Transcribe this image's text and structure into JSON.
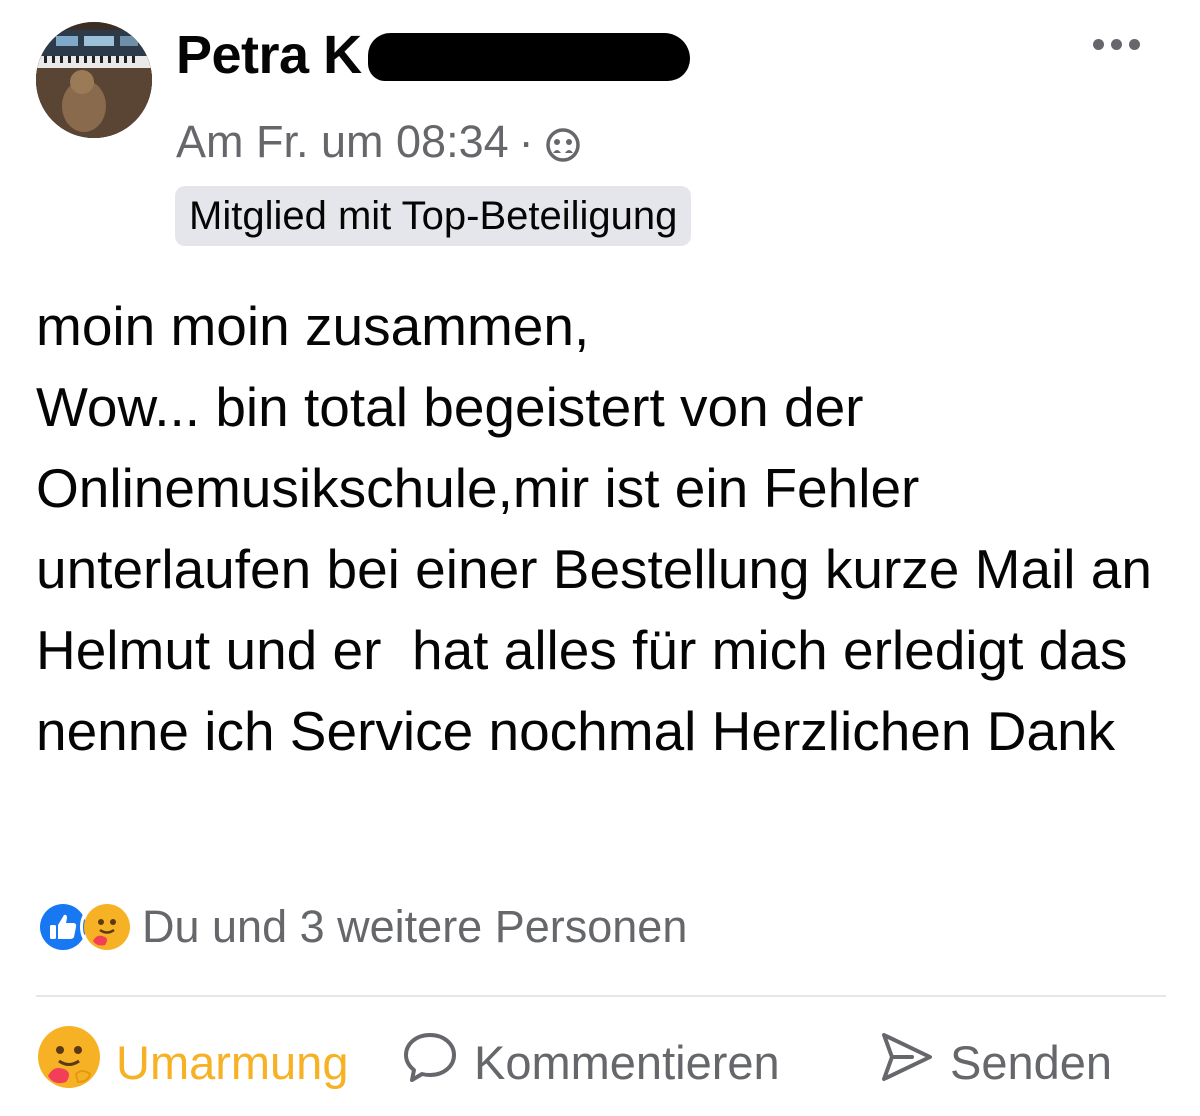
{
  "post": {
    "author": "Petra K",
    "timestamp": "Am Fr. um 08:34",
    "separator": "·",
    "privacy_icon": "group-members-icon",
    "badge": "Mitglied mit Top-Beteiligung",
    "body": "moin moin zusammen,\nWow... bin total begeistert von der Onlinemusikschule,mir ist ein Fehler unterlaufen bei einer Bestellung kurze Mail an Helmut und er  hat alles für mich erledigt das nenne ich Service nochmal Herzlichen Dank"
  },
  "reactions": {
    "icons": [
      "like-icon",
      "care-icon"
    ],
    "summary": "Du und 3 weitere Personen"
  },
  "actions": {
    "hug_label": "Umarmung",
    "comment_label": "Kommentieren",
    "send_label": "Senden"
  },
  "colors": {
    "secondary_text": "#65676b",
    "like_blue": "#1877f2",
    "care_yellow": "#f7b125",
    "badge_bg": "#e4e6eb"
  }
}
